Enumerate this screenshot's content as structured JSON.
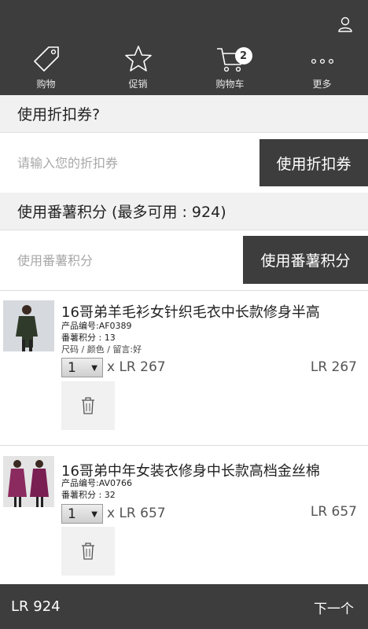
{
  "nav": {
    "tabs": [
      {
        "label": "购物",
        "icon": "tag-icon"
      },
      {
        "label": "促销",
        "icon": "star-icon"
      },
      {
        "label": "购物车",
        "icon": "cart-icon",
        "badge": "2"
      },
      {
        "label": "更多",
        "icon": "more-icon"
      }
    ]
  },
  "coupon": {
    "title": "使用折扣券?",
    "placeholder": "请输入您的折扣券",
    "button_label": "使用折扣券"
  },
  "points": {
    "title": "使用番薯积分 (最多可用 : 924)",
    "placeholder": "使用番薯积分",
    "button_label": "使用番薯积分"
  },
  "cart": {
    "items": [
      {
        "title": "16哥弟羊毛衫女针织毛衣中长款修身半高",
        "product_code": "产品编号:AF0389",
        "points": "番薯积分 : 13",
        "options": "尺码 / 颜色 / 留言:好",
        "quantity": "1",
        "unit_price": "x LR 267",
        "line_total": "LR 267"
      },
      {
        "title": "16哥弟中年女装衣修身中长款高档金丝棉",
        "product_code": "产品编号:AV0766",
        "points": "番薯积分 : 32",
        "quantity": "1",
        "unit_price": "x LR 657",
        "line_total": "LR 657"
      }
    ]
  },
  "footer": {
    "total": "LR 924",
    "next_label": "下一个"
  },
  "colors": {
    "bar": "#3d3d3d",
    "section_bg": "#f1f1f1"
  }
}
